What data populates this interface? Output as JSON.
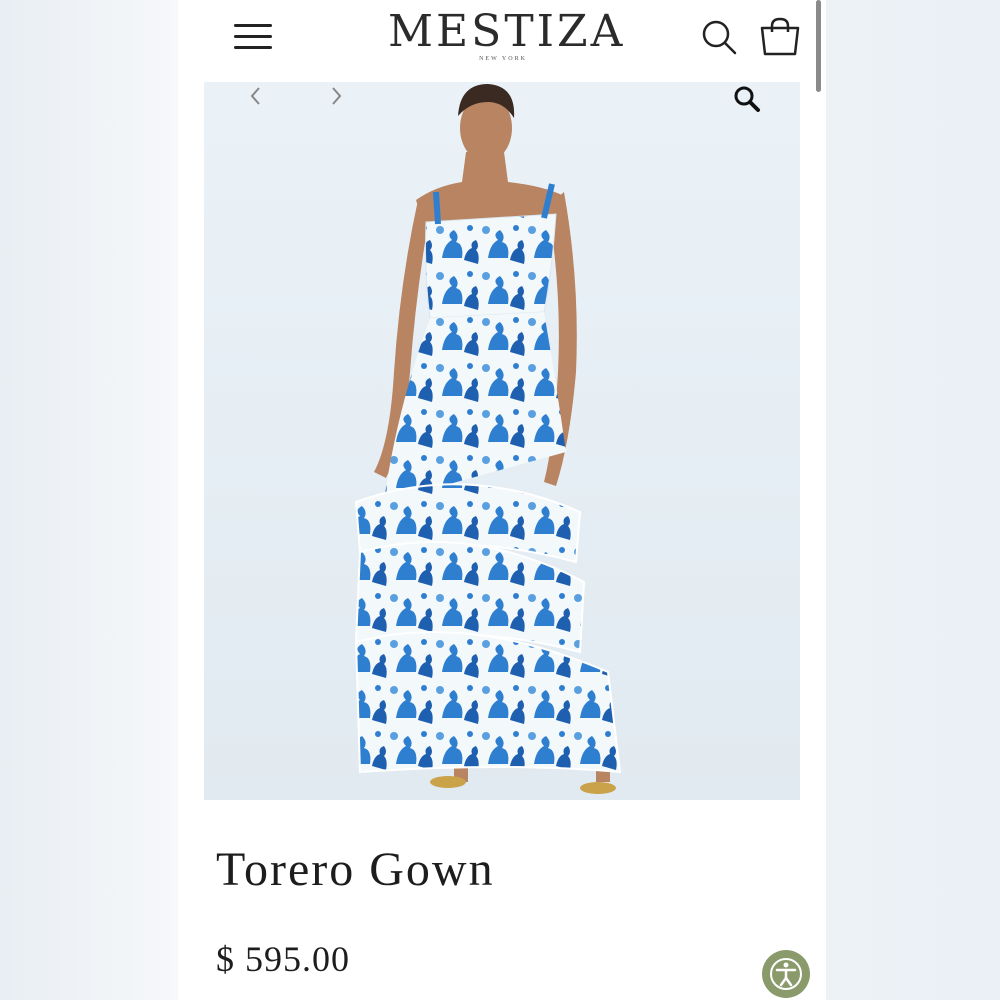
{
  "header": {
    "brand": "MESTIZA",
    "brand_sub": "NEW YORK",
    "menu_icon": "hamburger-menu-icon",
    "search_icon": "search-icon",
    "bag_icon": "shopping-bag-icon"
  },
  "gallery": {
    "prev_icon": "chevron-left-icon",
    "next_icon": "chevron-right-icon",
    "zoom_icon": "zoom-icon",
    "image_subject": "model wearing blue and white toile print tiered gown"
  },
  "product": {
    "title": "Torero Gown",
    "price": "$ 595.00"
  },
  "accessibility": {
    "icon": "accessibility-icon"
  },
  "colors": {
    "accent_green": "#8a9a6b",
    "print_blue": "#2f7fd0",
    "text": "#1d1d1d"
  }
}
